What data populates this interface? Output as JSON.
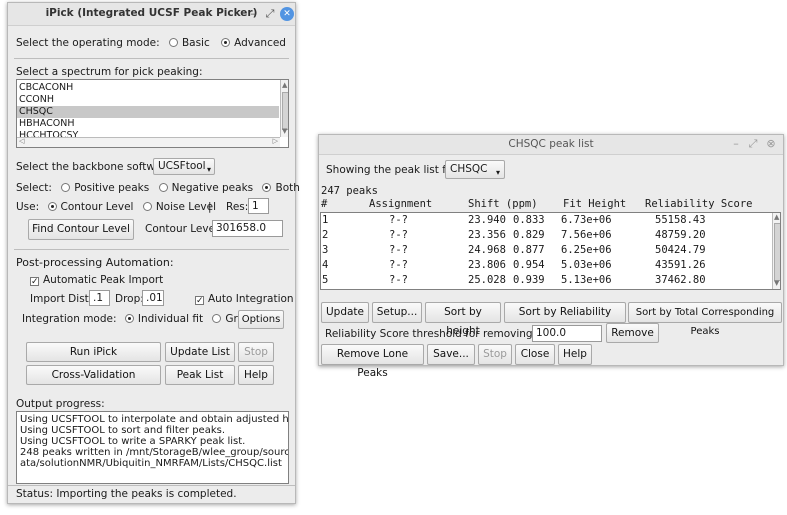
{
  "ipick": {
    "title": "iPick (Integrated UCSF Peak Picker)",
    "mode_label": "Select the operating mode:",
    "mode_basic": "Basic",
    "mode_advanced": "Advanced",
    "spectrum_label": "Select a spectrum for pick peaking:",
    "spectra": [
      "CBCACONH",
      "CCONH",
      "CHSQC",
      "HBHACONH",
      "HCCHTOCSY"
    ],
    "selected_spectrum": "CHSQC",
    "backbone_label": "Select the backbone software:",
    "backbone_value": "UCSFtool",
    "select_label": "Select:",
    "positive_peaks": "Positive peaks",
    "negative_peaks": "Negative peaks",
    "both": "Both",
    "use_label": "Use:",
    "contour_level": "Contour Level",
    "noise_level": "Noise Level",
    "pipe": "|",
    "res_label": "Res:",
    "res_value": "1",
    "find_contour_btn": "Find Contour Level",
    "contour_level_label": "Contour Level:",
    "contour_level_value": "301658.0",
    "post_label": "Post-processing Automation:",
    "auto_import": "Automatic Peak Import",
    "import_dist_label": "Import Dist.:",
    "import_dist_value": ".1",
    "drop_label": "Drop:",
    "drop_value": ".01",
    "auto_integration": "Auto Integration",
    "integration_mode_label": "Integration mode:",
    "individual_fit": "Individual fit",
    "group_fit": "Group fit",
    "options_btn": "Options",
    "run_btn": "Run iPick",
    "update_list_btn": "Update List",
    "stop_btn": "Stop",
    "cross_validation_btn": "Cross-Validation",
    "peak_list_btn": "Peak List",
    "help_btn": "Help",
    "output_label": "Output progress:",
    "output_lines": [
      "Using UCSFTOOL to interpolate and obtain adjusted heights.",
      "Using UCSFTOOL to sort and filter peaks.",
      "Using UCSFTOOL to write a SPARKY peak list.",
      "248 peaks written in /mnt/StorageB/wlee_group/source/nmrd",
      "ata/solutionNMR/Ubiquitin_NMRFAM/Lists/CHSQC.list"
    ],
    "status": "Status: Importing the peaks is completed."
  },
  "peaklist": {
    "title": "CHSQC peak list",
    "showing_label": "Showing the peak list for:",
    "showing_value": "CHSQC",
    "count_text": "247 peaks",
    "headers": [
      "#",
      "Assignment",
      "Shift (ppm)",
      "Fit Height",
      "Reliability Score"
    ],
    "rows": [
      [
        "1",
        "?-?",
        "23.940",
        "0.833",
        "6.73e+06",
        "55158.43"
      ],
      [
        "2",
        "?-?",
        "23.356",
        "0.829",
        "7.56e+06",
        "48759.20"
      ],
      [
        "3",
        "?-?",
        "24.968",
        "0.877",
        "6.25e+06",
        "50424.79"
      ],
      [
        "4",
        "?-?",
        "23.806",
        "0.954",
        "5.03e+06",
        "43591.26"
      ],
      [
        "5",
        "?-?",
        "25.028",
        "0.939",
        "5.13e+06",
        "37462.80"
      ]
    ],
    "update_btn": "Update",
    "setup_btn": "Setup...",
    "sort_height_btn": "Sort by height",
    "sort_reliability_btn": "Sort by Reliability Score",
    "sort_total_btn": "Sort by Total Corresponding Peaks",
    "threshold_label": "Reliability Score threshold for removing peaks:",
    "threshold_value": "100.0",
    "remove_btn": "Remove",
    "remove_lone_btn": "Remove Lone Peaks",
    "save_btn": "Save...",
    "stop_btn": "Stop",
    "close_btn": "Close",
    "help_btn": "Help"
  }
}
